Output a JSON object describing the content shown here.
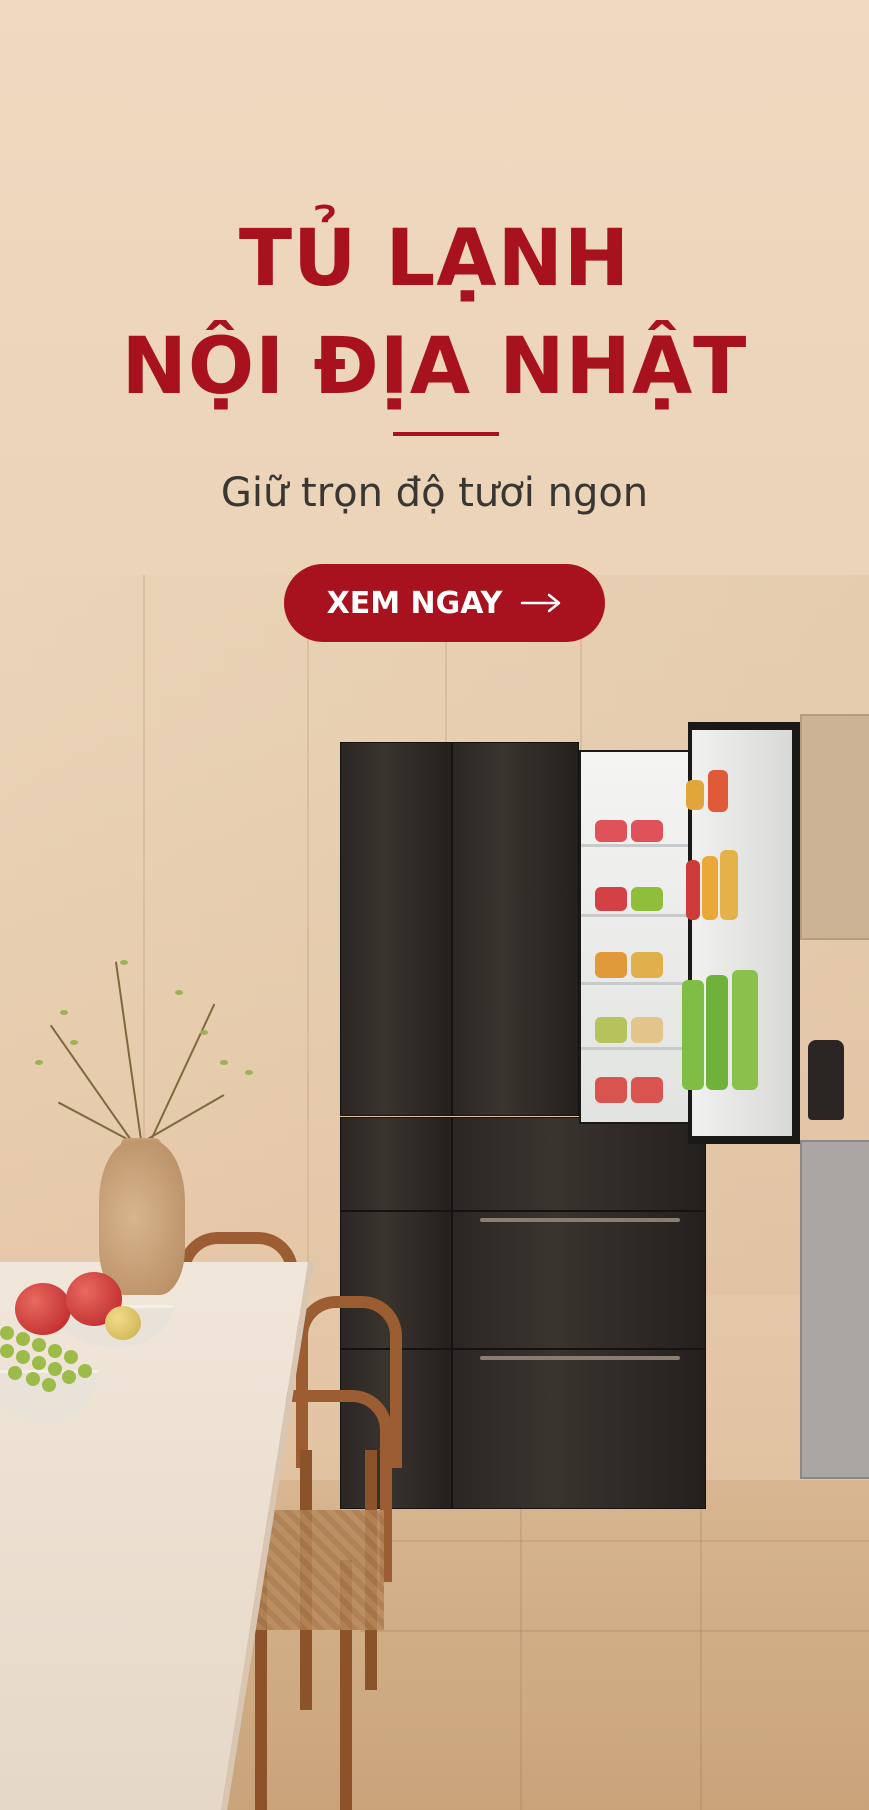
{
  "banner": {
    "headline_line1": "TỦ LẠNH",
    "headline_line2": "NỘI ĐỊA NHẬT",
    "subtitle": "Giữ trọn độ tươi ngon",
    "cta_label": "XEM NGAY",
    "cta_icon": "arrow-right-icon"
  },
  "colors": {
    "brand_red": "#a8121e",
    "background": "#efd9c0",
    "subtitle_text": "#3a3632"
  }
}
